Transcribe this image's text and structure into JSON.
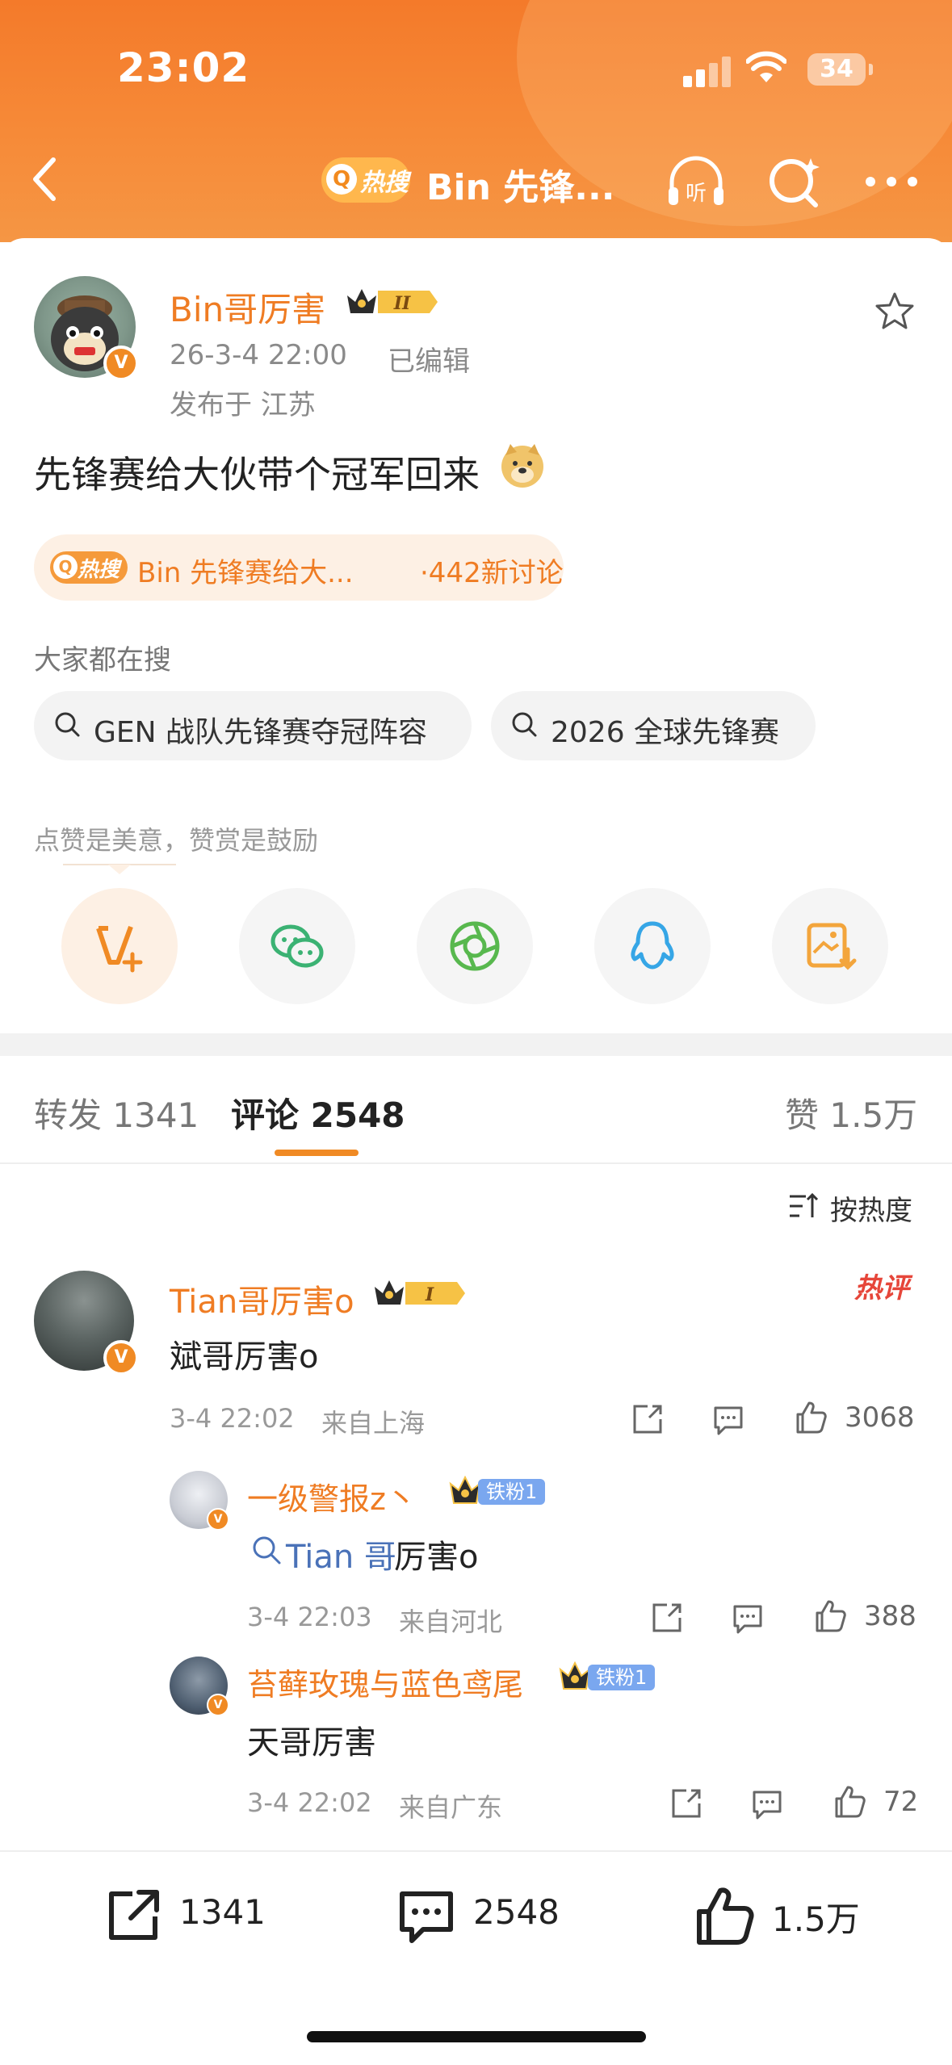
{
  "status_bar": {
    "time": "23:02",
    "battery": "34"
  },
  "nav": {
    "hot_tag": "热搜",
    "title": "Bin 先锋..."
  },
  "post": {
    "author": "Bin哥厉害",
    "crown_level": "II",
    "date": "26-3-4 22:00",
    "edited": "已编辑",
    "location": "发布于 江苏",
    "text": "先锋赛给大伙带个冠军回来",
    "topic": {
      "tag": "热搜",
      "text": "Bin 先锋赛给大...",
      "count": "·442新讨论"
    },
    "search_label": "大家都在搜",
    "search_chips": [
      "GEN 战队先锋赛夺冠阵容",
      "2026 全球先锋赛"
    ],
    "reward_label": "点赞是美意，赞赏是鼓励"
  },
  "tabs": {
    "repost_label": "转发",
    "repost_count": "1341",
    "comment_label": "评论",
    "comment_count": "2548",
    "like_label": "赞",
    "like_count": "1.5万"
  },
  "sort_label": "按热度",
  "comments": [
    {
      "name": "Tian哥厉害o",
      "crown_level": "I",
      "hot_label": "热评",
      "text": "斌哥厉害o",
      "time": "3-4 22:02",
      "location": "来自上海",
      "likes": "3068",
      "replies": [
        {
          "name": "一级警报z丶",
          "fan": "铁粉1",
          "mention": "Tian 哥",
          "text": "厉害o",
          "time": "3-4 22:03",
          "location": "来自河北",
          "likes": "388"
        },
        {
          "name": "苔藓玫瑰与蓝色鸢尾",
          "fan": "铁粉1",
          "text": "天哥厉害",
          "time": "3-4 22:02",
          "location": "来自广东",
          "likes": "72"
        }
      ]
    }
  ],
  "bottom_bar": {
    "repost": "1341",
    "comment": "2548",
    "like": "1.5万"
  },
  "colors": {
    "brand_orange": "#ef7c23",
    "header_orange": "#f47a2a",
    "hot_red": "#e6463a",
    "fan_blue": "#7aa7ef"
  }
}
